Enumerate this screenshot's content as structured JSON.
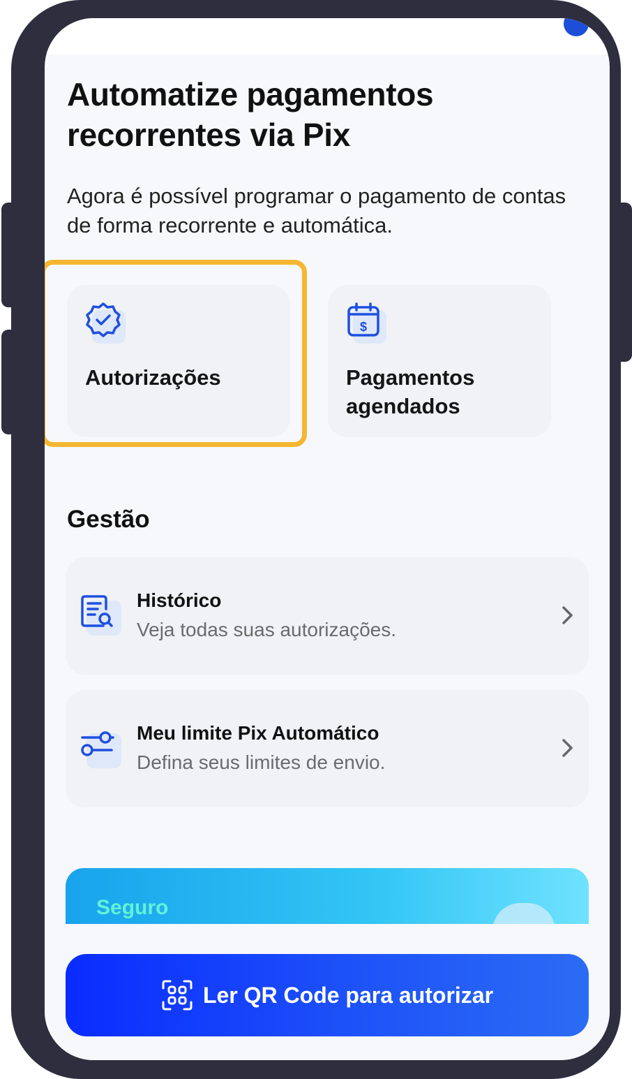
{
  "header": {
    "title": "Automatize pagamentos recorrentes via Pix",
    "subtitle": "Agora é possível programar o pagamento de contas de forma recorrente e automática."
  },
  "cards": [
    {
      "label": "Autorizações",
      "icon": "badge-check-icon",
      "highlighted": true
    },
    {
      "label": "Pagamentos agendados",
      "icon": "calendar-dollar-icon",
      "highlighted": false
    }
  ],
  "management": {
    "title": "Gestão",
    "items": [
      {
        "title": "Histórico",
        "description": "Veja todas suas autorizações.",
        "icon": "document-search-icon"
      },
      {
        "title": "Meu limite Pix Automático",
        "description": "Defina seus limites de envio.",
        "icon": "sliders-icon"
      }
    ]
  },
  "banner": {
    "text": "Seguro"
  },
  "cta": {
    "label": "Ler QR Code para autorizar",
    "icon": "qr-code-icon"
  },
  "colors": {
    "accent": "#1f4fe0",
    "highlight": "#f5b731",
    "cta_start": "#0a2cff",
    "cta_end": "#2b6cf4",
    "frame": "#2e2e3f"
  }
}
